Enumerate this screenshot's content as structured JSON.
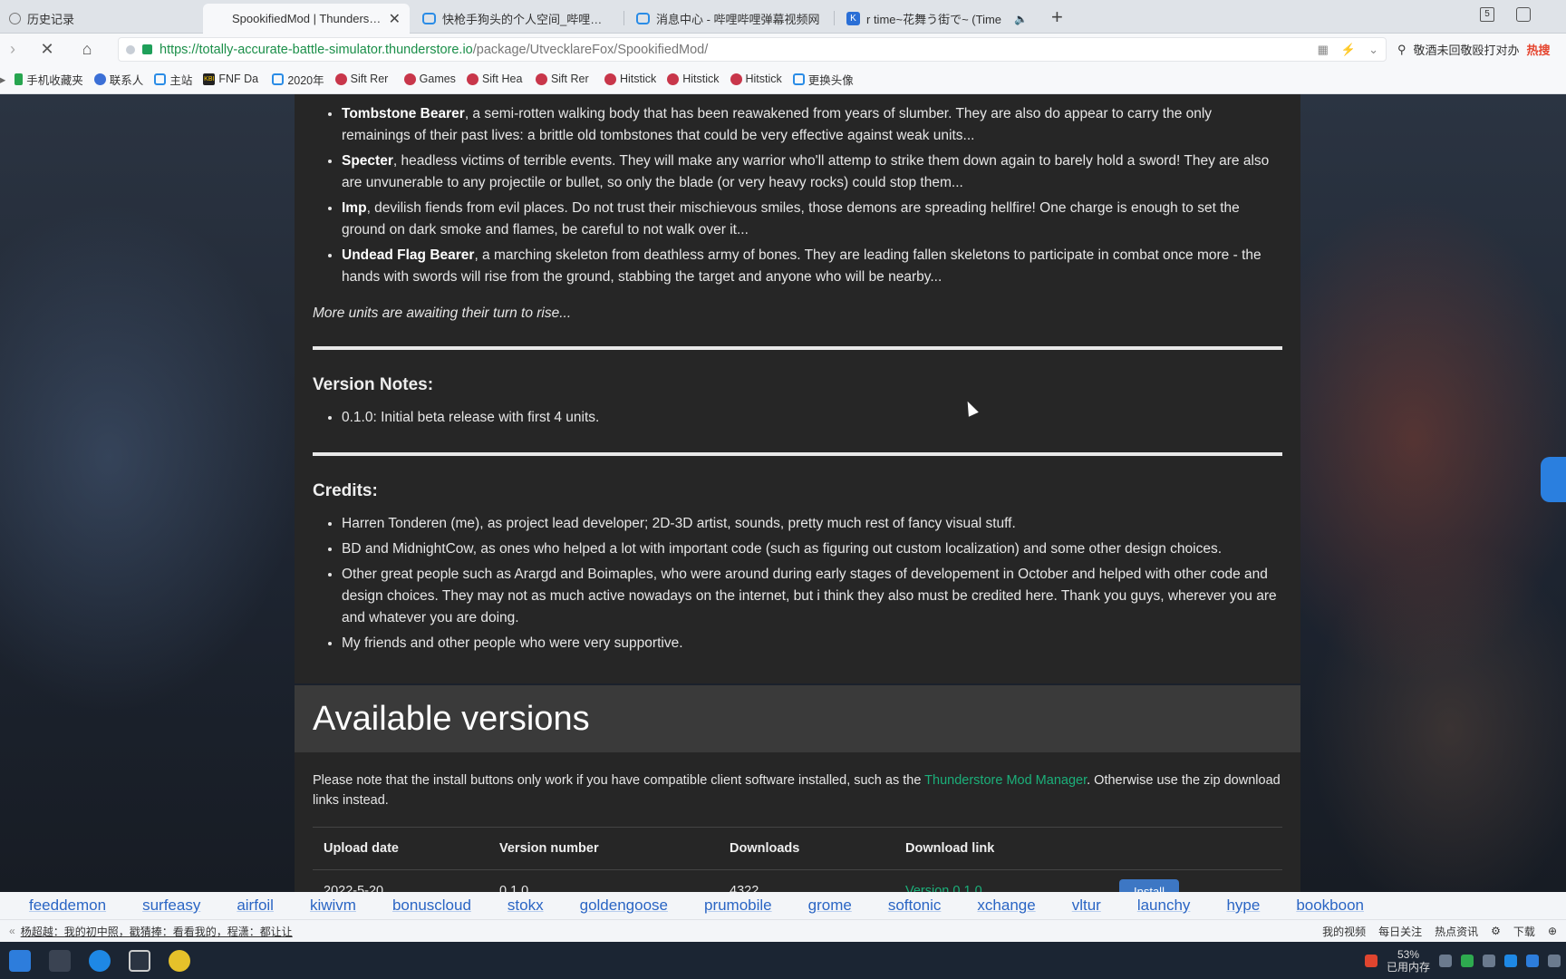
{
  "tabs": [
    {
      "label": "历史记录",
      "icon": "history-icon"
    },
    {
      "label": "SpookifiedMod | Thunderstore",
      "icon": "none",
      "active": true
    },
    {
      "label": "快枪手狗头的个人空间_哔哩哔哩",
      "icon": "bilibili-icon"
    },
    {
      "label": "消息中心 - 哔哩哔哩弹幕视频网",
      "icon": "bilibili-icon"
    },
    {
      "label": "r time~花舞う街で~ (Time",
      "icon": "k-icon"
    }
  ],
  "window": {
    "tab_count_badge": "5"
  },
  "address": {
    "host": "https://totally-accurate-battle-simulator.thunderstore.io",
    "path": "/package/UtvecklareFox/SpookifiedMod/"
  },
  "search": {
    "text": "敬酒未回敬殴打对办",
    "hot": "热搜"
  },
  "bookmarks": [
    {
      "label": "手机收藏夹",
      "icon": "phone-icon"
    },
    {
      "label": "联系人",
      "icon": "contacts-icon"
    },
    {
      "label": "主站",
      "icon": "bilibili-icon"
    },
    {
      "label": "FNF Da",
      "icon": "fnf-icon"
    },
    {
      "label": "2020年",
      "icon": "bilibili-icon"
    },
    {
      "label": "Sift Rer",
      "icon": "sift-icon"
    },
    {
      "label": "Games",
      "icon": "sift-icon"
    },
    {
      "label": "Sift Hea",
      "icon": "sift-icon"
    },
    {
      "label": "Sift Rer",
      "icon": "sift-icon"
    },
    {
      "label": "Hitstick",
      "icon": "sift-icon"
    },
    {
      "label": "Hitstick",
      "icon": "sift-icon"
    },
    {
      "label": "Hitstick",
      "icon": "sift-icon"
    },
    {
      "label": "更换头像",
      "icon": "bilibili-icon"
    }
  ],
  "units": [
    {
      "name": "Tombstone Bearer",
      "desc": ", a semi-rotten walking body that has been reawakened from years of slumber. They are also do appear to carry the only remainings of their past lives: a brittle old tombstones that could be very effective against weak units..."
    },
    {
      "name": "Specter",
      "desc": ", headless victims of terrible events. They will make any warrior who'll attemp to strike them down again to barely hold a sword! They are also are unvunerable to any projectile or bullet, so only the blade (or very heavy rocks) could stop them..."
    },
    {
      "name": "Imp",
      "desc": ", devilish fiends from evil places. Do not trust their mischievous smiles, those demons are spreading hellfire! One charge is enough to set the ground on dark smoke and flames, be careful to not walk over it..."
    },
    {
      "name": "Undead Flag Bearer",
      "desc": ", a marching skeleton from deathless army of bones. They are leading fallen skeletons to participate in combat once more - the hands with swords will rise from the ground, stabbing the target and anyone who will be nearby..."
    }
  ],
  "more_units": "More units are awaiting their turn to rise...",
  "version_notes": {
    "title": "Version Notes:",
    "items": [
      "0.1.0: Initial beta release with first 4 units."
    ]
  },
  "credits": {
    "title": "Credits:",
    "items": [
      "Harren Tonderen (me), as project lead developer; 2D-3D artist, sounds, pretty much rest of fancy visual stuff.",
      "BD and MidnightCow, as ones who helped a lot with important code (such as figuring out custom localization) and some other design choices.",
      "Other great people such as Arargd and Boimaples, who were around during early stages of developement in October and helped with other code and design choices. They may not as much active nowadays on the internet, but i think they also must be credited here. Thank you guys, wherever you are and whatever you are doing.",
      "My friends and other people who were very supportive."
    ]
  },
  "available_versions": {
    "title": "Available versions",
    "note_pre": "Please note that the install buttons only work if you have compatible client software installed, such as the ",
    "note_link": "Thunderstore Mod Manager",
    "note_post": ". Otherwise use the zip download links instead.",
    "headers": [
      "Upload date",
      "Version number",
      "Downloads",
      "Download link"
    ],
    "rows": [
      {
        "date": "2022-5-20",
        "version": "0.1.0",
        "downloads": "4322",
        "link": "Version 0.1.0",
        "install": "Install"
      }
    ]
  },
  "ad_links": [
    "feeddemon",
    "surfeasy",
    "airfoil",
    "kiwivm",
    "bonuscloud",
    "stokx",
    "goldengoose",
    "prumobile",
    "grome",
    "softonic",
    "xchange",
    "vltur",
    "launchy",
    "hype",
    "bookboon"
  ],
  "statusbar": {
    "news": "杨超越：我的初中照，戳猜捧：看看我的，程潇：都让让",
    "items": [
      "我的视频",
      "每日关注",
      "热点资讯",
      "下载"
    ]
  },
  "taskbar": {
    "mem_percent": "53%",
    "mem_label": "已用内存"
  },
  "colors": {
    "link_green": "#1bb07a",
    "panel_bg": "#262626",
    "accent_blue": "#3d77c4"
  }
}
